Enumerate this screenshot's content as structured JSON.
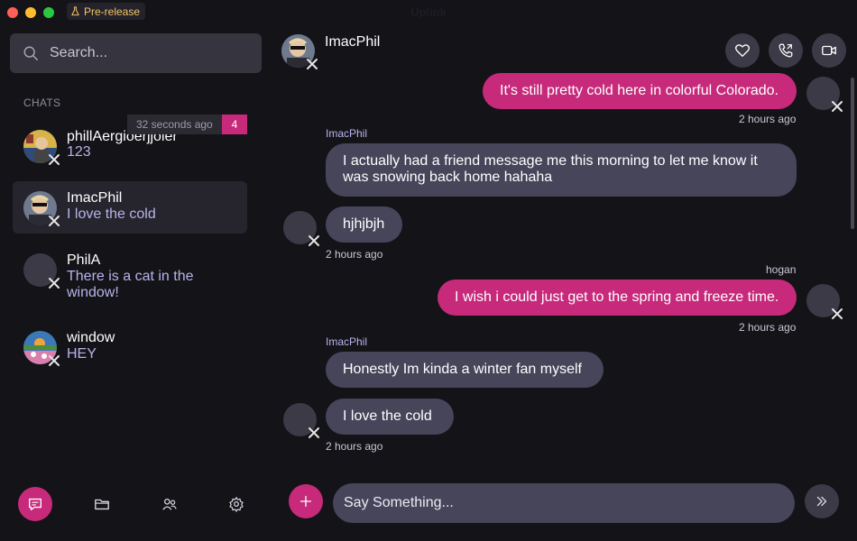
{
  "window": {
    "title": "Uplink",
    "badge": "Pre-release"
  },
  "colors": {
    "accent": "#c72a7b",
    "bubble_remote": "#47455a",
    "background": "#141318",
    "preview_text": "#b7b4ec"
  },
  "sidebar": {
    "search_placeholder": "Search...",
    "section_label": "CHATS",
    "tooltip": "32 seconds ago",
    "chats": [
      {
        "name": "phillAergioerjjoier",
        "preview": "123",
        "unread": "4",
        "avatar": "photo-icon"
      },
      {
        "name": "ImacPhil",
        "preview": "I love the cold",
        "active": true,
        "avatar": "photo-icon"
      },
      {
        "name": "PhilA",
        "preview": "There is a cat in the window!",
        "avatar": "blank"
      },
      {
        "name": "window",
        "preview": "HEY",
        "avatar": "photo-icon"
      }
    ],
    "nav": [
      "chat-icon",
      "folder-icon",
      "friends-icon",
      "settings-icon"
    ]
  },
  "header": {
    "name": "ImacPhil",
    "actions": [
      "heart-icon",
      "call-icon",
      "video-icon"
    ]
  },
  "messages": [
    {
      "side": "local",
      "text": "It's still pretty cold here in colorful Colorado.",
      "time": "2 hours ago"
    },
    {
      "side": "remote",
      "sender": "ImacPhil",
      "text": "I actually had a friend message me this morning to let me know it was snowing back home hahaha"
    },
    {
      "side": "remote",
      "text": "hjhjbjh",
      "time": "2 hours ago"
    },
    {
      "side": "local",
      "sender": "hogan",
      "text": "I wish i could just get to the spring and freeze time.",
      "time": "2 hours ago"
    },
    {
      "side": "remote",
      "sender": "ImacPhil",
      "text": "Honestly Im kinda a winter fan myself"
    },
    {
      "side": "remote",
      "text": "I love the cold",
      "time": "2 hours ago"
    }
  ],
  "composer": {
    "placeholder": "Say Something..."
  }
}
